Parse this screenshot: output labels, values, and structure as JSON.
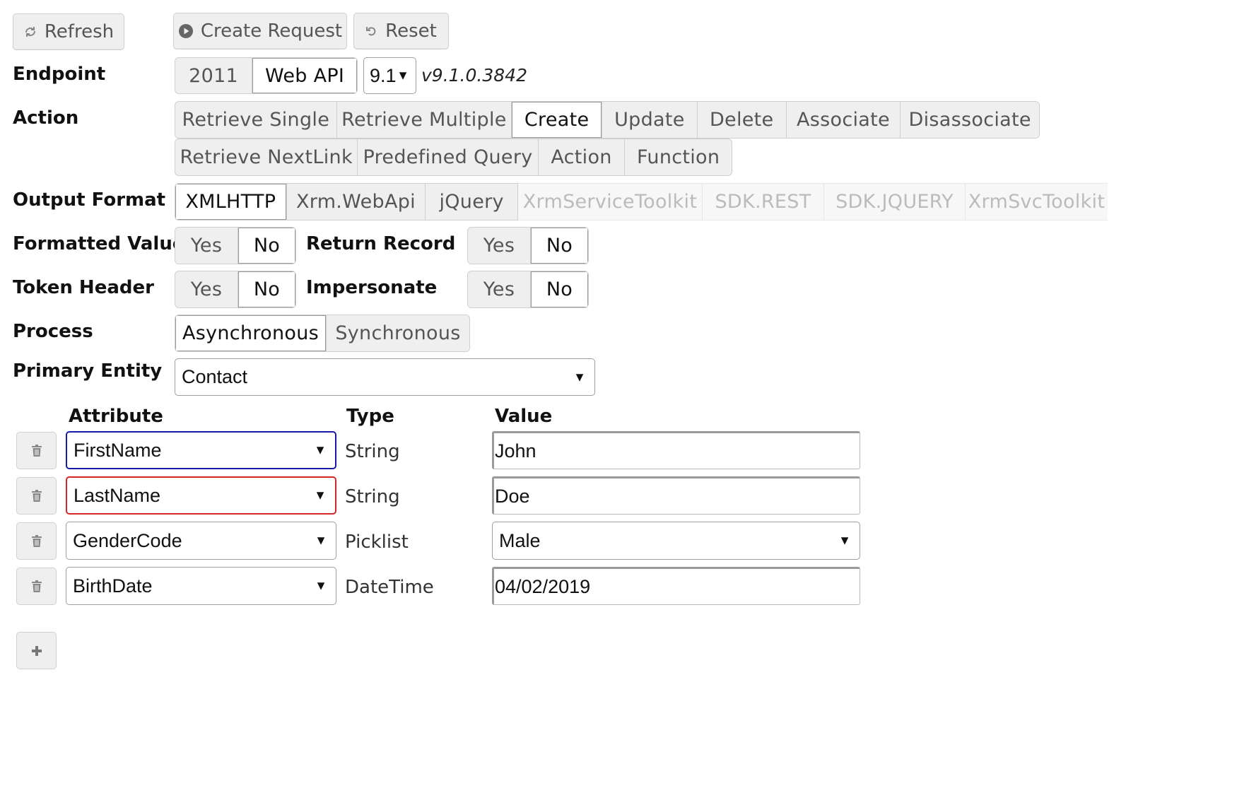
{
  "toolbar": {
    "refresh_label": "Refresh",
    "create_request_label": "Create Request",
    "reset_label": "Reset"
  },
  "endpoint": {
    "label": "Endpoint",
    "options": [
      "2011",
      "Web API"
    ],
    "selected": "Web API",
    "version": "9.1",
    "version_full": "v9.1.0.3842"
  },
  "action": {
    "label": "Action",
    "row1": [
      "Retrieve Single",
      "Retrieve Multiple",
      "Create",
      "Update",
      "Delete",
      "Associate",
      "Disassociate"
    ],
    "row2": [
      "Retrieve NextLink",
      "Predefined Query",
      "Action",
      "Function"
    ],
    "selected": "Create"
  },
  "output_format": {
    "label": "Output Format",
    "enabled": [
      "XMLHTTP",
      "Xrm.WebApi",
      "jQuery"
    ],
    "disabled": [
      "XrmServiceToolkit",
      "SDK.REST",
      "SDK.JQUERY",
      "XrmSvcToolkit"
    ],
    "selected": "XMLHTTP"
  },
  "formatted_values": {
    "label": "Formatted Values",
    "yes": "Yes",
    "no": "No",
    "selected": "No"
  },
  "return_record": {
    "label": "Return Record",
    "yes": "Yes",
    "no": "No",
    "selected": "No"
  },
  "token_header": {
    "label": "Token Header",
    "yes": "Yes",
    "no": "No",
    "selected": "No"
  },
  "impersonate": {
    "label": "Impersonate",
    "yes": "Yes",
    "no": "No",
    "selected": "No"
  },
  "process": {
    "label": "Process",
    "options": [
      "Asynchronous",
      "Synchronous"
    ],
    "selected": "Asynchronous"
  },
  "primary_entity": {
    "label": "Primary Entity",
    "value": "Contact"
  },
  "attributes_table": {
    "headers": {
      "attribute": "Attribute",
      "type": "Type",
      "value": "Value"
    },
    "rows": [
      {
        "attribute": "FirstName",
        "type": "String",
        "value": "John",
        "focus_color": "#1a1aa8"
      },
      {
        "attribute": "LastName",
        "type": "String",
        "value": "Doe",
        "focus_color": "#d42626"
      },
      {
        "attribute": "GenderCode",
        "type": "Picklist",
        "value": "Male"
      },
      {
        "attribute": "BirthDate",
        "type": "DateTime",
        "value": "04/02/2019"
      }
    ]
  },
  "icons": {
    "refresh": "refresh-icon",
    "create": "play-circle-icon",
    "reset": "undo-icon",
    "delete": "trash-icon",
    "add": "plus-icon"
  },
  "colors": {
    "button_bg": "#efefef",
    "active_bg": "#ffffff",
    "disabled_text": "#bbbbbb"
  }
}
